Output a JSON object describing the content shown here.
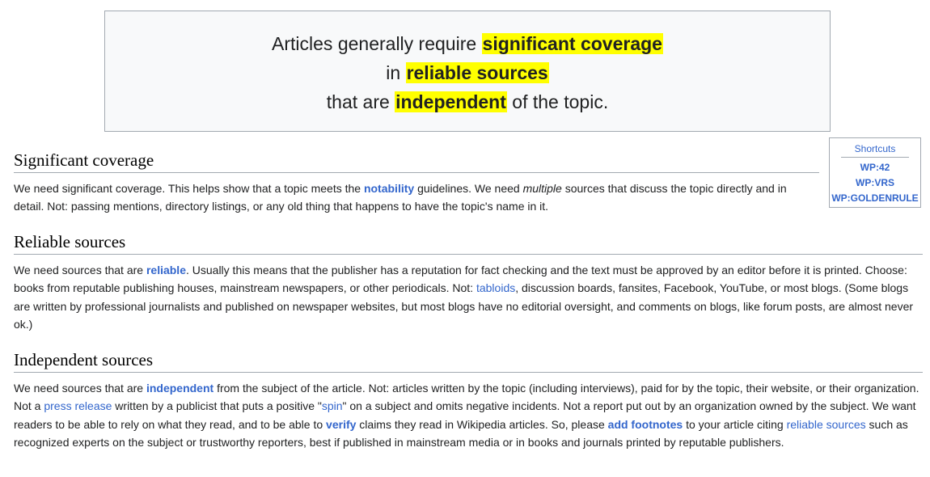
{
  "banner": {
    "l1a": "Articles generally require ",
    "l1b": "significant coverage",
    "l2a": "in ",
    "l2b": "reliable sources",
    "l3a": "that are ",
    "l3b": "independent",
    "l3c": " of the topic."
  },
  "shortcuts": {
    "title": "Shortcuts",
    "items": [
      "WP:42",
      "WP:VRS",
      "WP:GOLDENRULE"
    ]
  },
  "sections": {
    "significant": {
      "heading": "Significant coverage",
      "t1": "We need significant coverage. This helps show that a topic meets the ",
      "link1": "notability",
      "t2": " guidelines. We need ",
      "em1": "multiple",
      "t3": " sources that discuss the topic directly and in detail. Not: passing mentions, directory listings, or any old thing that happens to have the topic's name in it."
    },
    "reliable": {
      "heading": "Reliable sources",
      "t1": "We need sources that are ",
      "link1": "reliable",
      "t2": ". Usually this means that the publisher has a reputation for fact checking and the text must be approved by an editor before it is printed. Choose: books from reputable publishing houses, mainstream newspapers, or other periodicals. Not: ",
      "link2": "tabloids",
      "t3": ", discussion boards, fansites, Facebook, YouTube, or most blogs. (Some blogs are written by professional journalists and published on newspaper websites, but most blogs have no editorial oversight, and comments on blogs, like forum posts, are almost never ok.)"
    },
    "independent": {
      "heading": "Independent sources",
      "t1": "We need sources that are ",
      "link1": "independent",
      "t2": " from the subject of the article. Not: articles written by the topic (including interviews), paid for by the topic, their website, or their organization. Not a ",
      "link2": "press release",
      "t3": " written by a publicist that puts a positive \"",
      "link3": "spin",
      "t4": "\" on a subject and omits negative incidents. Not a report put out by an organization owned by the subject. We want readers to be able to rely on what they read, and to be able to ",
      "link4": "verify",
      "t5": " claims they read in Wikipedia articles. So, please ",
      "link5": "add footnotes",
      "t6": " to your article citing ",
      "link6": "reliable sources",
      "t7": " such as recognized experts on the subject or trustworthy reporters, best if published in mainstream media or in books and journals printed by reputable publishers."
    }
  }
}
